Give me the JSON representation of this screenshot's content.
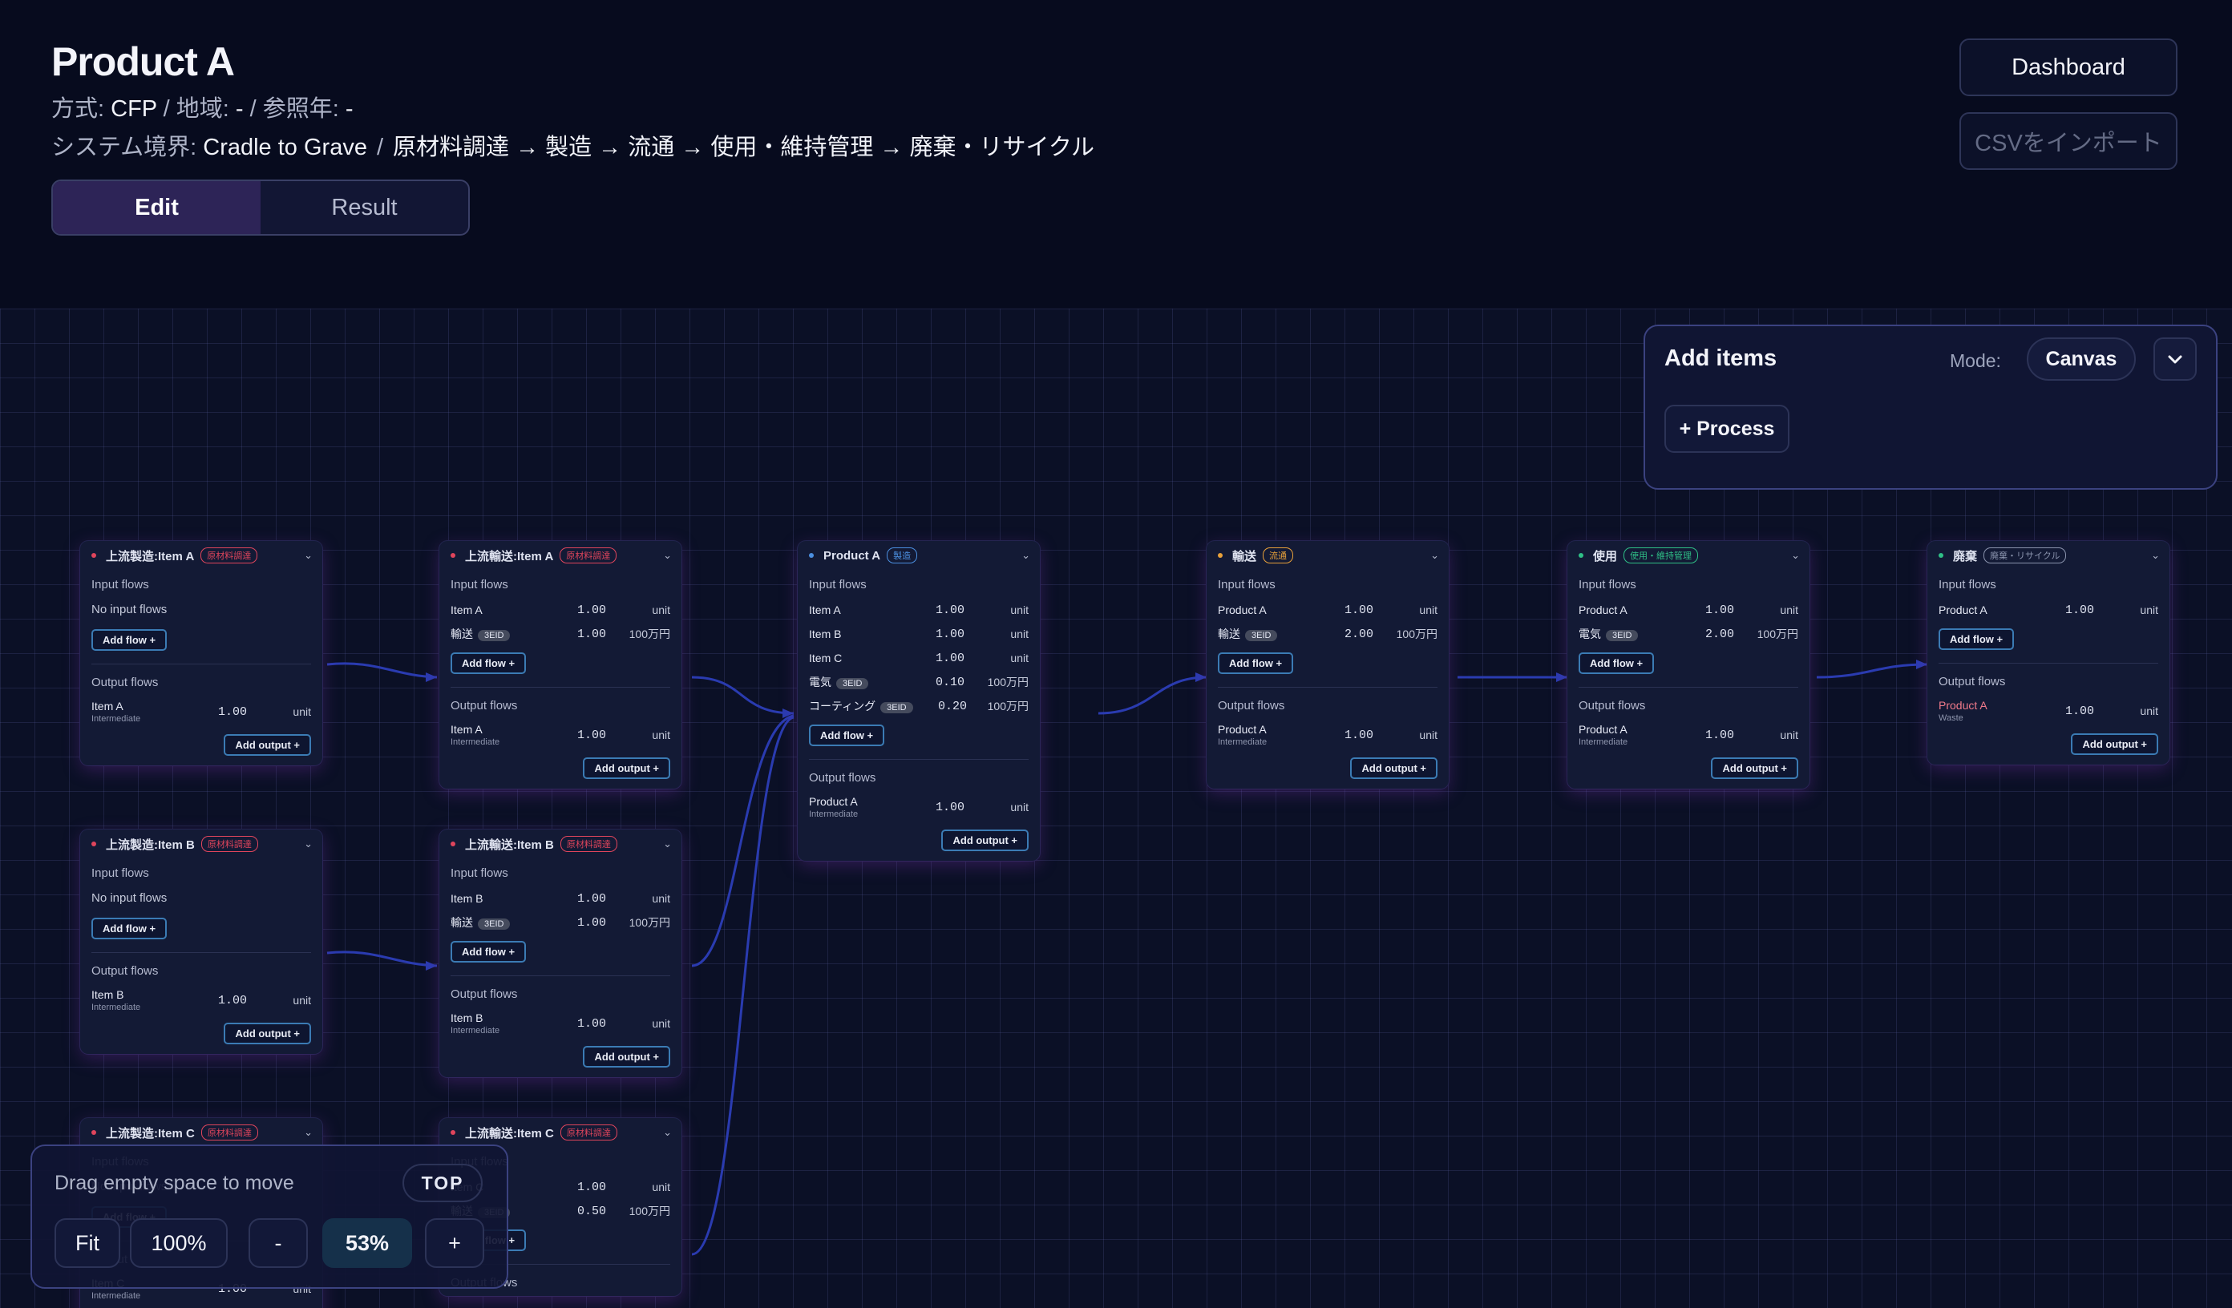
{
  "header": {
    "title": "Product A",
    "meta_line": {
      "method_label": "方式: ",
      "method": "CFP",
      "region_label": " / 地域: ",
      "region": "-",
      "year_label": " / 参照年: ",
      "year": "-"
    },
    "boundary_line": {
      "label": "システム境界: ",
      "value": "Cradle to Grave",
      "separator": "/",
      "stages": "原材料調達 → 製造 → 流通 → 使用・維持管理 → 廃棄・リサイクル"
    },
    "tabs": {
      "edit": "Edit",
      "result": "Result",
      "active": "Edit"
    },
    "buttons": {
      "dashboard": "Dashboard",
      "csv_import": "CSVをインポート"
    }
  },
  "add_items": {
    "title": "Add items",
    "mode_label": "Mode:",
    "mode_value": "Canvas",
    "process_button": "+ Process",
    "collapse_icon": "chevron-down-icon"
  },
  "zoom_controls": {
    "hint": "Drag empty space to move",
    "top": "TOP",
    "fit": "Fit",
    "reset": "100%",
    "zoom_out": "-",
    "level": "53%",
    "zoom_in": "+"
  },
  "labels": {
    "input_flows": "Input flows",
    "output_flows": "Output flows",
    "no_input": "No input flows",
    "add_flow": "Add flow +",
    "add_output": "Add output +"
  },
  "nodes": [
    {
      "title": "上流製造:Item A",
      "tag": "原材料調達",
      "tag_color": "#e0455c",
      "dot_color": "#e0455c",
      "inputs": [],
      "outputs": [
        {
          "name": "Item A",
          "sub": "Intermediate",
          "value": "1.00",
          "unit": "unit"
        }
      ]
    },
    {
      "title": "上流製造:Item B",
      "tag": "原材料調達",
      "tag_color": "#e0455c",
      "dot_color": "#e0455c",
      "inputs": [],
      "outputs": [
        {
          "name": "Item B",
          "sub": "Intermediate",
          "value": "1.00",
          "unit": "unit"
        }
      ]
    },
    {
      "title": "上流製造:Item C",
      "tag": "原材料調達",
      "tag_color": "#e0455c",
      "dot_color": "#e0455c",
      "inputs": [],
      "outputs": [
        {
          "name": "Item C",
          "sub": "Intermediate",
          "value": "1.00",
          "unit": "unit"
        }
      ]
    },
    {
      "title": "上流輸送:Item A",
      "tag": "原材料調達",
      "tag_color": "#e0455c",
      "dot_color": "#e0455c",
      "inputs": [
        {
          "name": "Item A",
          "value": "1.00",
          "unit": "unit"
        },
        {
          "name": "輸送",
          "badge": "3EID",
          "value": "1.00",
          "unit": "100万円"
        }
      ],
      "outputs": [
        {
          "name": "Item A",
          "sub": "Intermediate",
          "value": "1.00",
          "unit": "unit"
        }
      ]
    },
    {
      "title": "上流輸送:Item B",
      "tag": "原材料調達",
      "tag_color": "#e0455c",
      "dot_color": "#e0455c",
      "inputs": [
        {
          "name": "Item B",
          "value": "1.00",
          "unit": "unit"
        },
        {
          "name": "輸送",
          "badge": "3EID",
          "value": "1.00",
          "unit": "100万円"
        }
      ],
      "outputs": [
        {
          "name": "Item B",
          "sub": "Intermediate",
          "value": "1.00",
          "unit": "unit"
        }
      ]
    },
    {
      "title": "上流輸送:Item C",
      "tag": "原材料調達",
      "tag_color": "#e0455c",
      "dot_color": "#e0455c",
      "inputs": [
        {
          "name": "Item C",
          "value": "1.00",
          "unit": "unit"
        },
        {
          "name": "輸送",
          "badge": "3EID",
          "value": "0.50",
          "unit": "100万円"
        }
      ],
      "outputs": []
    },
    {
      "title": "Product A",
      "tag": "製造",
      "tag_color": "#4b8fe0",
      "dot_color": "#4b8fe0",
      "inputs": [
        {
          "name": "Item A",
          "value": "1.00",
          "unit": "unit"
        },
        {
          "name": "Item B",
          "value": "1.00",
          "unit": "unit"
        },
        {
          "name": "Item C",
          "value": "1.00",
          "unit": "unit"
        },
        {
          "name": "電気",
          "badge": "3EID",
          "value": "0.10",
          "unit": "100万円"
        },
        {
          "name": "コーティング",
          "badge": "3EID",
          "value": "0.20",
          "unit": "100万円"
        }
      ],
      "outputs": [
        {
          "name": "Product A",
          "sub": "Intermediate",
          "value": "1.00",
          "unit": "unit"
        }
      ]
    },
    {
      "title": "輸送",
      "tag": "流通",
      "tag_color": "#e8a13a",
      "dot_color": "#e8a13a",
      "inputs": [
        {
          "name": "Product A",
          "value": "1.00",
          "unit": "unit"
        },
        {
          "name": "輸送",
          "badge": "3EID",
          "value": "2.00",
          "unit": "100万円"
        }
      ],
      "outputs": [
        {
          "name": "Product A",
          "sub": "Intermediate",
          "value": "1.00",
          "unit": "unit"
        }
      ]
    },
    {
      "title": "使用",
      "tag": "使用・維持管理",
      "tag_color": "#2fbf86",
      "dot_color": "#2fbf86",
      "inputs": [
        {
          "name": "Product A",
          "value": "1.00",
          "unit": "unit"
        },
        {
          "name": "電気",
          "badge": "3EID",
          "value": "2.00",
          "unit": "100万円"
        }
      ],
      "outputs": [
        {
          "name": "Product A",
          "sub": "Intermediate",
          "value": "1.00",
          "unit": "unit"
        }
      ]
    },
    {
      "title": "廃棄",
      "tag": "廃棄・リサイクル",
      "tag_color": "#8a93ad",
      "dot_color": "#2fbf86",
      "inputs": [
        {
          "name": "Product A",
          "value": "1.00",
          "unit": "unit"
        }
      ],
      "outputs": [
        {
          "name": "Product A",
          "sub": "Waste",
          "value": "1.00",
          "unit": "unit",
          "name_color": "#f07a8a"
        }
      ]
    }
  ]
}
